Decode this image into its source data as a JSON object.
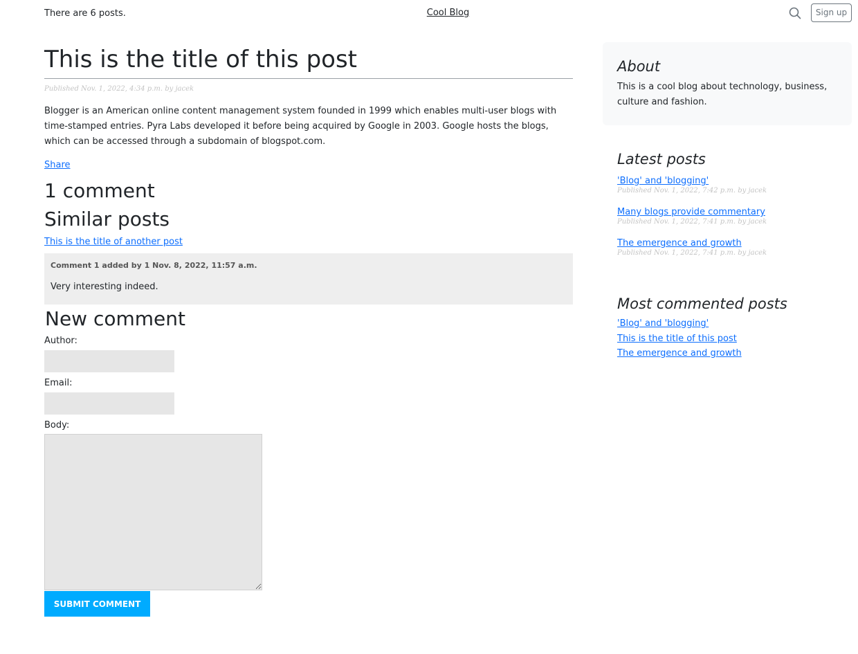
{
  "header": {
    "post_count_text": "There are 6 posts.",
    "blog_title": "Cool Blog",
    "search_icon": "search-icon",
    "signup_label": "Sign up"
  },
  "post": {
    "title": "This is the title of this post",
    "meta": "Published Nov. 1, 2022, 4:34 p.m. by jacek",
    "body": "Blogger is an American online content management system founded in 1999 which enables multi-user blogs with time-stamped entries. Pyra Labs developed it before being acquired by Google in 2003. Google hosts the blogs, which can be accessed through a subdomain of blogspot.com.",
    "share_label": "Share"
  },
  "comments": {
    "heading": "1 comment",
    "items": [
      {
        "info": "Comment 1 added by 1 Nov. 8, 2022, 11:57 a.m.",
        "text": "Very interesting indeed."
      }
    ]
  },
  "similar": {
    "heading": "Similar posts",
    "items": [
      {
        "label": "This is the title of another post"
      }
    ]
  },
  "new_comment": {
    "heading": "New comment",
    "author_label": "Author:",
    "author_value": "",
    "email_label": "Email:",
    "email_value": "",
    "body_label": "Body:",
    "body_value": "",
    "submit_label": "SUBMIT COMMENT"
  },
  "sidebar": {
    "about": {
      "heading": "About",
      "text": "This is a cool blog about technology, business, culture and fashion."
    },
    "latest": {
      "heading": "Latest posts",
      "items": [
        {
          "label": "'Blog' and 'blogging'",
          "meta": "Published Nov. 1, 2022, 7:42 p.m. by jacek"
        },
        {
          "label": "Many blogs provide commentary",
          "meta": "Published Nov. 1, 2022, 7:41 p.m. by jacek"
        },
        {
          "label": "The emergence and growth",
          "meta": "Published Nov. 1, 2022, 7:41 p.m. by jacek"
        }
      ]
    },
    "most_commented": {
      "heading": "Most commented posts",
      "items": [
        {
          "label": "'Blog' and 'blogging'"
        },
        {
          "label": "This is the title of this post"
        },
        {
          "label": "The emergence and growth"
        }
      ]
    }
  },
  "colors": {
    "link": "#0d6efd",
    "submit_button": "#00abff",
    "comment_bg": "#eeeeee",
    "input_bg": "#e6e6e6",
    "about_bg": "#f8f9fa",
    "meta_text": "#c4c4c4"
  }
}
